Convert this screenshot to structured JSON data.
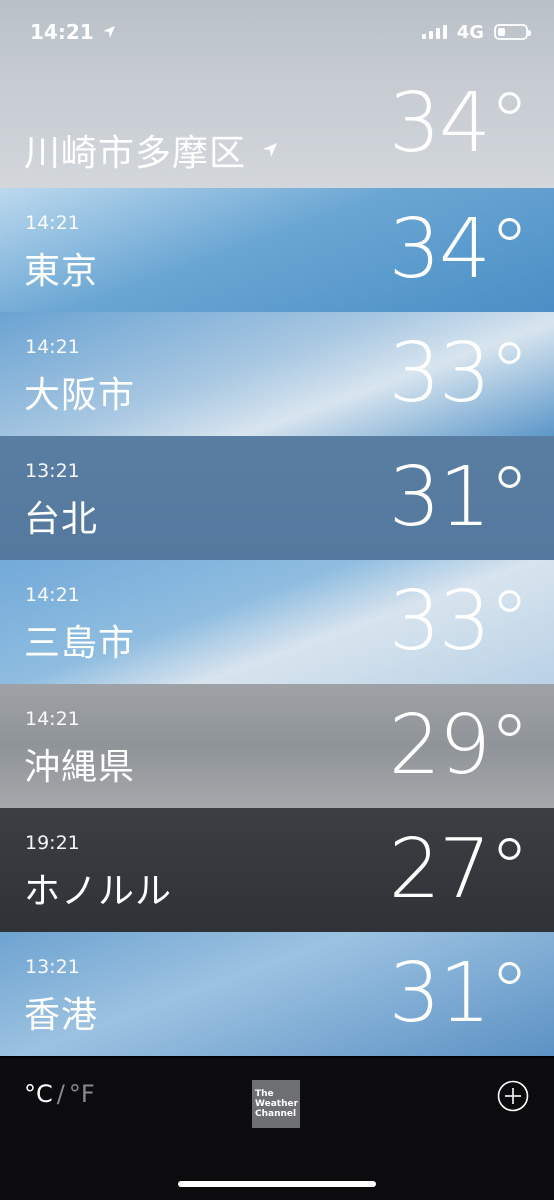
{
  "status": {
    "time": "14:21",
    "network": "4G",
    "battery_level": 0.25
  },
  "cities": [
    {
      "time": "",
      "name": "川崎市多摩区",
      "temp": "34°",
      "is_current_location": true,
      "bg": "linear-gradient(180deg,#b9c0c7 0%,#c6ccd2 45%,#d3d7dc 100%)"
    },
    {
      "time": "14:21",
      "name": "東京",
      "temp": "34°",
      "bg": "linear-gradient(160deg,#bcd9ee 0%,#6aa6d3 45%,#4b8fc6 100%)"
    },
    {
      "time": "14:21",
      "name": "大阪市",
      "temp": "33°",
      "bg": "linear-gradient(160deg,#6aa3d2 0%,#a9c8e2 45%,#d8e5ef 65%,#5b97c9 100%)"
    },
    {
      "time": "13:21",
      "name": "台北",
      "temp": "31°",
      "bg": "linear-gradient(180deg,#5a7ea2 0%,#55799e 100%)"
    },
    {
      "time": "14:21",
      "name": "三島市",
      "temp": "33°",
      "bg": "linear-gradient(160deg,#73aad8 0%,#8fbde0 40%,#d8e4ee 60%,#b9d2e6 100%)"
    },
    {
      "time": "14:21",
      "name": "沖縄県",
      "temp": "29°",
      "bg": "linear-gradient(180deg,#9ea2a6 0%,#8f9498 50%,#a5a8ab 100%)"
    },
    {
      "time": "19:21",
      "name": "ホノルル",
      "temp": "27°",
      "bg": "linear-gradient(180deg,#3b3f44 0%,#2f3337 100%)"
    },
    {
      "time": "13:21",
      "name": "香港",
      "temp": "31°",
      "bg": "linear-gradient(160deg,#6ea3d0 0%,#9cc2e1 40%,#5c92c4 100%)"
    }
  ],
  "toolbar": {
    "celsius": "°C",
    "separator": "/",
    "fahrenheit": "°F",
    "logo_text": [
      "The",
      "Weather",
      "Channel"
    ],
    "add_icon": "plus-circle-icon"
  }
}
